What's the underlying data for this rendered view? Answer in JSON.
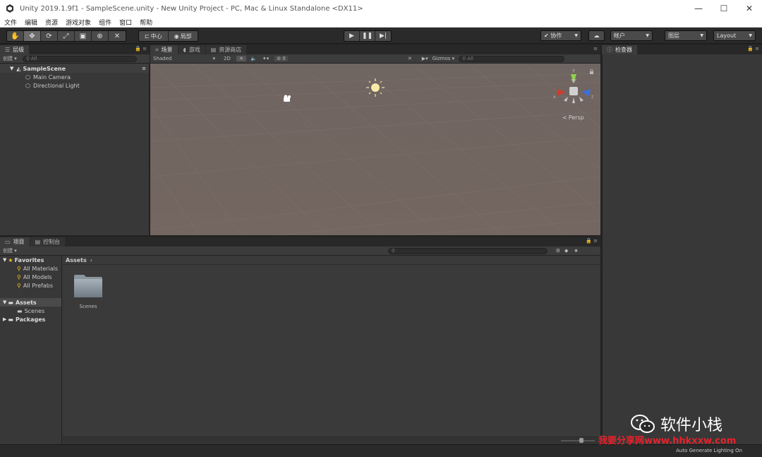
{
  "window": {
    "title": "Unity 2019.1.9f1 - SampleScene.unity - New Unity Project - PC, Mac & Linux Standalone <DX11>",
    "minimize": "—",
    "maximize": "☐",
    "close": "✕"
  },
  "menu": [
    "文件",
    "编辑",
    "资源",
    "游戏对象",
    "组件",
    "窗口",
    "帮助"
  ],
  "toolbar": {
    "pivot": "中心",
    "local": "局部",
    "collab": "协作",
    "account": "帐户",
    "layers": "图层",
    "layout": "Layout"
  },
  "hierarchy": {
    "tab": "层级",
    "create": "创建",
    "search_placeholder": "All",
    "scene": "SampleScene",
    "items": [
      "Main Camera",
      "Directional Light"
    ]
  },
  "scene_view": {
    "tabs": [
      "场景",
      "游戏",
      "资源商店"
    ],
    "shading": "Shaded",
    "mode_2d": "2D",
    "hidden_count": "0",
    "gizmos": "Gizmos",
    "search_placeholder": "All",
    "persp": "Persp",
    "axis_x": "x",
    "axis_y": "y",
    "axis_z": "z"
  },
  "inspector": {
    "tab": "检查器"
  },
  "project": {
    "tabs": [
      "项目",
      "控制台"
    ],
    "create": "创建",
    "favorites_label": "Favorites",
    "favorites": [
      "All Materials",
      "All Models",
      "All Prefabs"
    ],
    "assets_label": "Assets",
    "assets_children": [
      "Scenes"
    ],
    "packages_label": "Packages",
    "breadcrumb": "Assets",
    "folder_name": "Scenes"
  },
  "status": {
    "lighting": "Auto Generate Lighting On"
  },
  "watermark": {
    "brand": "软件小栈",
    "site": "我要分享网www.hhkxxw.com"
  },
  "colors": {
    "scene_bg": "#726560",
    "panel_bg": "#383838",
    "watermark_red": "#e8212a"
  }
}
